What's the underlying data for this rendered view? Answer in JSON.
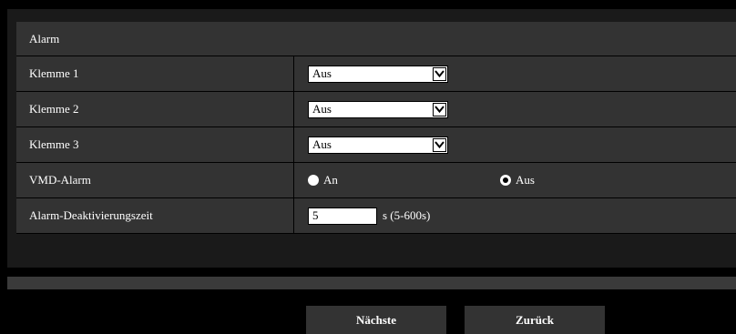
{
  "section": {
    "title": "Alarm"
  },
  "rows": [
    {
      "label": "Klemme 1",
      "value": "Aus"
    },
    {
      "label": "Klemme 2",
      "value": "Aus"
    },
    {
      "label": "Klemme 3",
      "value": "Aus"
    }
  ],
  "vmd": {
    "label": "VMD-Alarm",
    "option_on": "An",
    "option_off": "Aus",
    "selected": "Aus"
  },
  "deactivation": {
    "label": "Alarm-Deaktivierungszeit",
    "value": "5",
    "unit": "s (5-600s)"
  },
  "buttons": {
    "next": "Nächste",
    "back": "Zurück"
  }
}
